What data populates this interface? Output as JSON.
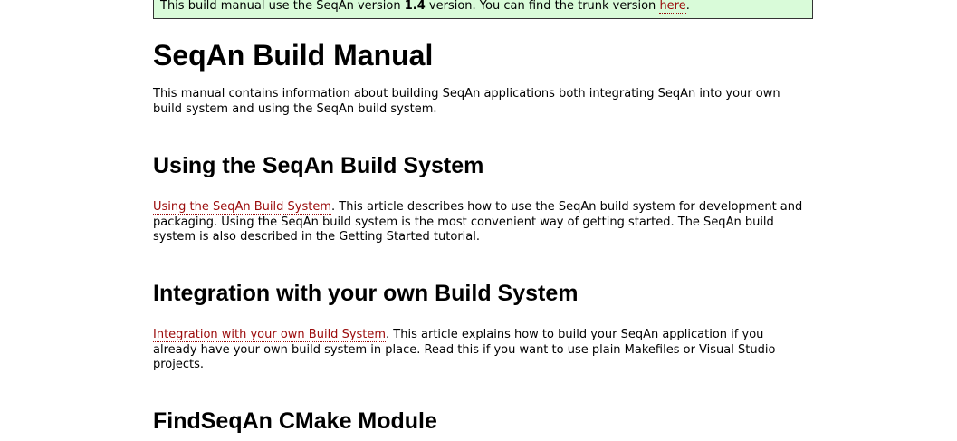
{
  "notice": {
    "prefix": "This build manual use the SeqAn version ",
    "version": "1.4",
    "middle": " version. You can find the trunk version ",
    "link": "here",
    "suffix": "."
  },
  "title": "SeqAn Build Manual",
  "intro": "This manual contains information about building SeqAn applications both integrating SeqAn into your own build system and using the SeqAn build system.",
  "sections": [
    {
      "heading": "Using the SeqAn Build System",
      "link": "Using the SeqAn Build System",
      "text": ". This article describes how to use the SeqAn build system for development and packaging. Using the SeqAn build system is the most convenient way of getting started. The SeqAn build system is also described in the Getting Started tutorial."
    },
    {
      "heading": "Integration with your own Build System",
      "link": "Integration with your own Build System",
      "text": ". This article explains how to build your SeqAn application if you already have your own build system in place. Read this if you want to use plain Makefiles or Visual Studio projects."
    },
    {
      "heading": "FindSeqAn CMake Module"
    }
  ],
  "colors": {
    "notice_bg": "#d9fbd9",
    "link": "#9a0a0a"
  }
}
